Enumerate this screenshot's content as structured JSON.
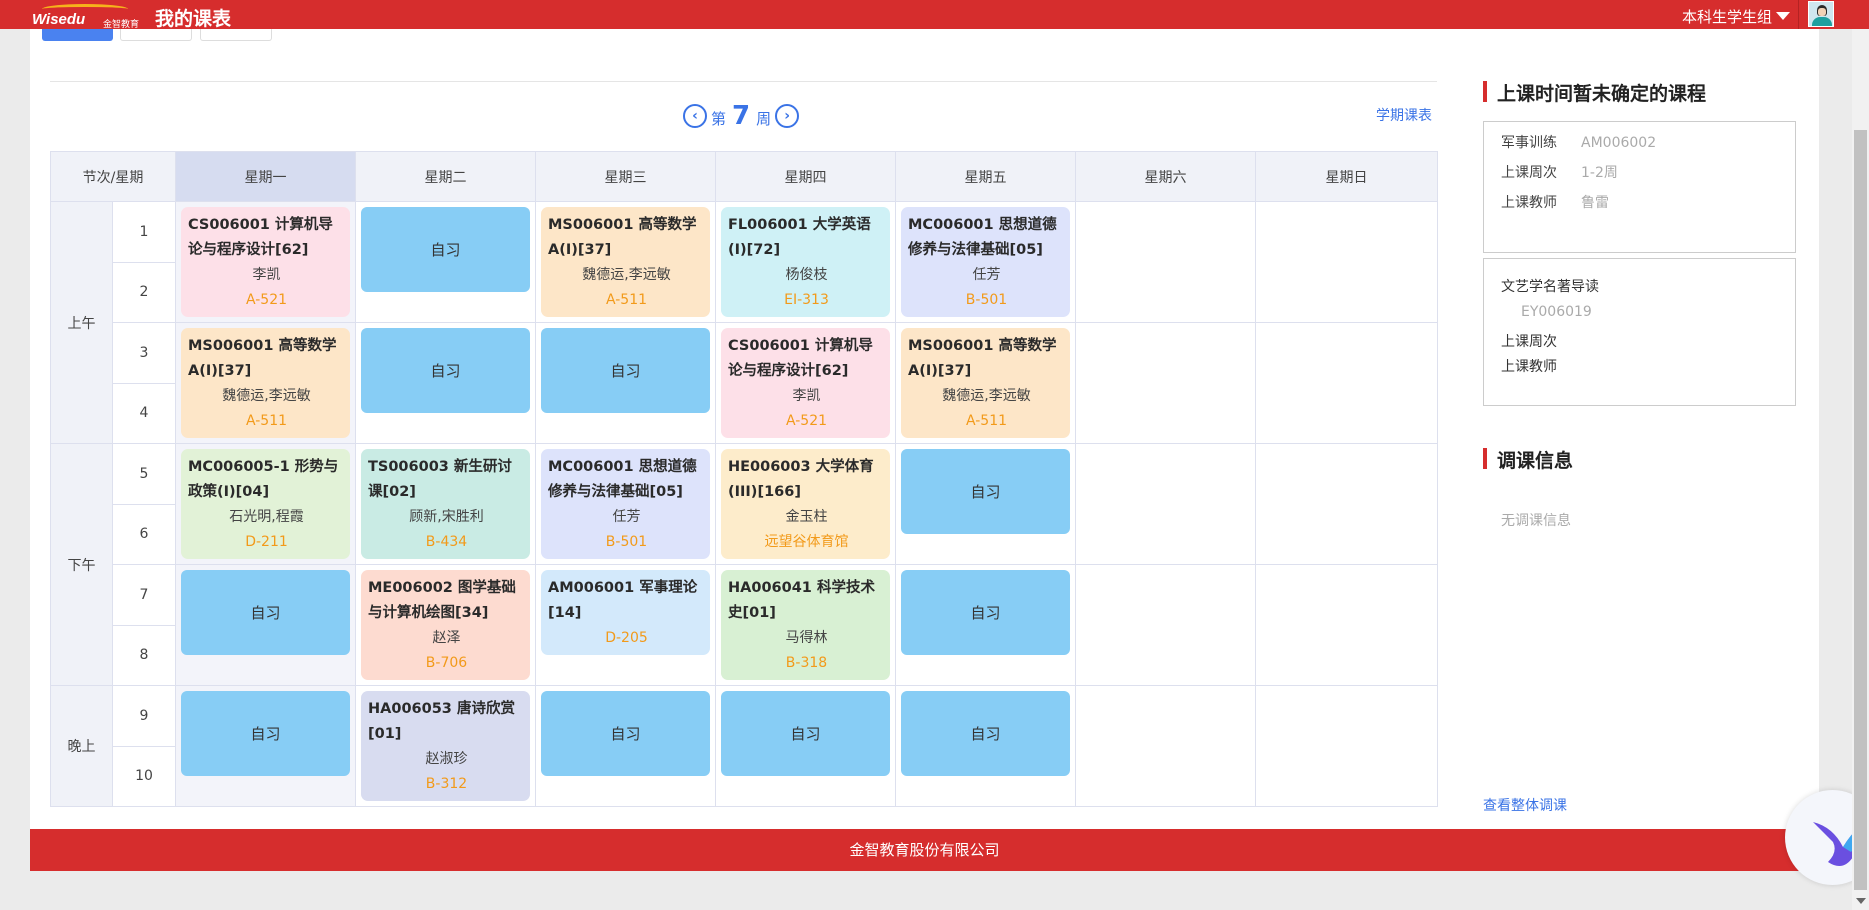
{
  "header": {
    "logo_text": "Wisedu",
    "logo_sub": "金智教育",
    "app_title": "我的课表",
    "role": "本科生学生组"
  },
  "week_nav": {
    "prefix": "第",
    "number": "7",
    "suffix": "周",
    "prev_icon": "‹",
    "next_icon": "›",
    "term_link": "学期课表"
  },
  "timetable": {
    "corner": "节次/星期",
    "days": [
      "星期一",
      "星期二",
      "星期三",
      "星期四",
      "星期五",
      "星期六",
      "星期日"
    ],
    "periods": {
      "morning": "上午",
      "afternoon": "下午",
      "evening": "晚上"
    },
    "period_numbers": [
      "1",
      "2",
      "3",
      "4",
      "5",
      "6",
      "7",
      "8",
      "9",
      "10"
    ],
    "self_study": "自习",
    "courses": {
      "b1_mon": {
        "name": "CS006001 计算机导论与程序设计[62]",
        "teacher": "李凯",
        "room": "A-521"
      },
      "b1_wed": {
        "name": "MS006001 高等数学A(Ⅰ)[37]",
        "teacher": "魏德运,李远敏",
        "room": "A-511"
      },
      "b1_thu": {
        "name": "FL006001 大学英语(Ⅰ)[72]",
        "teacher": "杨俊枝",
        "room": "EI-313"
      },
      "b1_fri": {
        "name": "MC006001 思想道德修养与法律基础[05]",
        "teacher": "任芳",
        "room": "B-501"
      },
      "b2_mon": {
        "name": "MS006001 高等数学A(Ⅰ)[37]",
        "teacher": "魏德运,李远敏",
        "room": "A-511"
      },
      "b2_thu": {
        "name": "CS006001 计算机导论与程序设计[62]",
        "teacher": "李凯",
        "room": "A-521"
      },
      "b2_fri": {
        "name": "MS006001 高等数学A(Ⅰ)[37]",
        "teacher": "魏德运,李远敏",
        "room": "A-511"
      },
      "b3_mon": {
        "name": "MC006005-1 形势与政策(Ⅰ)[04]",
        "teacher": "石光明,程霞",
        "room": "D-211"
      },
      "b3_tue": {
        "name": "TS006003 新生研讨课[02]",
        "teacher": "顾新,宋胜利",
        "room": "B-434"
      },
      "b3_wed": {
        "name": "MC006001 思想道德修养与法律基础[05]",
        "teacher": "任芳",
        "room": "B-501"
      },
      "b3_thu": {
        "name": "HE006003 大学体育(III)[166]",
        "teacher": "金玉柱",
        "room": "远望谷体育馆"
      },
      "b4_tue": {
        "name": "ME006002 图学基础与计算机绘图[34]",
        "teacher": "赵泽",
        "room": "B-706"
      },
      "b4_wed": {
        "name": "AM006001 军事理论[14]",
        "teacher": "",
        "room": "D-205"
      },
      "b4_thu": {
        "name": "HA006041 科学技术史[01]",
        "teacher": "马得林",
        "room": "B-318"
      },
      "b5_tue": {
        "name": "HA006053 唐诗欣赏[01]",
        "teacher": "赵淑珍",
        "room": "B-312"
      }
    }
  },
  "sidebar": {
    "unscheduled_title": "上课时间暂未确定的课程",
    "unscheduled": [
      {
        "name": "军事训练",
        "code": "AM006002",
        "weeks_label": "上课周次",
        "weeks": "1-2周",
        "teacher_label": "上课教师",
        "teacher": "鲁雷"
      },
      {
        "name": "文艺学名著导读",
        "code": "EY006019",
        "weeks_label": "上课周次",
        "weeks": "",
        "teacher_label": "上课教师",
        "teacher": ""
      }
    ],
    "adjust_title": "调课信息",
    "no_adjust": "无调课信息",
    "view_all": "查看整体调课"
  },
  "footer": {
    "company": "金智教育股份有限公司"
  },
  "colors": {
    "brand_red": "#d62d2d",
    "link_blue": "#3a73e6",
    "room_orange": "#f29a1a",
    "self_study_blue": "#87cdf5"
  }
}
